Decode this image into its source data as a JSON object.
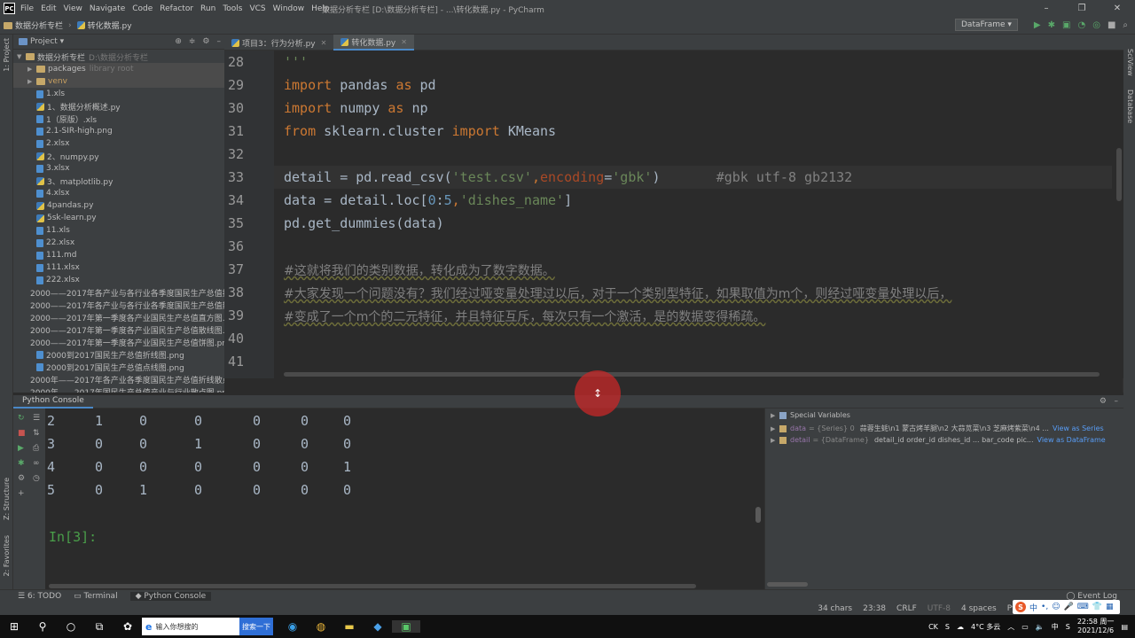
{
  "titlebar": {
    "logo": "PC",
    "menu": [
      "File",
      "Edit",
      "View",
      "Navigate",
      "Code",
      "Refactor",
      "Run",
      "Tools",
      "VCS",
      "Window",
      "Help"
    ],
    "window_title": "数据分析专栏 [D:\\数据分析专栏] - ...\\转化数据.py - PyCharm",
    "controls": [
      "–",
      "❐",
      "✕"
    ]
  },
  "navbar": {
    "crumbs": [
      "数据分析专栏",
      "转化数据.py"
    ],
    "run_config": "DataFrame ▾"
  },
  "project_panel": {
    "title": "Project ▾",
    "tree": [
      {
        "name": "数据分析专栏",
        "extra": "D:\\数据分析专栏",
        "type": "folder",
        "arrow": "▼"
      },
      {
        "name": "packages",
        "extra": "library root",
        "type": "folder",
        "arrow": "▶"
      },
      {
        "name": "venv",
        "extra": "",
        "type": "folder",
        "arrow": "▶"
      },
      {
        "name": "1.xls",
        "extra": "",
        "type": "file",
        "arrow": ""
      },
      {
        "name": "1、数据分析概述.py",
        "extra": "",
        "type": "py",
        "arrow": ""
      },
      {
        "name": "1（原版）.xls",
        "extra": "",
        "type": "file",
        "arrow": ""
      },
      {
        "name": "2.1-SIR-high.png",
        "extra": "",
        "type": "file",
        "arrow": ""
      },
      {
        "name": "2.xlsx",
        "extra": "",
        "type": "file",
        "arrow": ""
      },
      {
        "name": "2、numpy.py",
        "extra": "",
        "type": "py",
        "arrow": ""
      },
      {
        "name": "3.xlsx",
        "extra": "",
        "type": "file",
        "arrow": ""
      },
      {
        "name": "3、matplotlib.py",
        "extra": "",
        "type": "py",
        "arrow": ""
      },
      {
        "name": "4.xlsx",
        "extra": "",
        "type": "file",
        "arrow": ""
      },
      {
        "name": "4pandas.py",
        "extra": "",
        "type": "py",
        "arrow": ""
      },
      {
        "name": "5sk-learn.py",
        "extra": "",
        "type": "py",
        "arrow": ""
      },
      {
        "name": "11.xls",
        "extra": "",
        "type": "file",
        "arrow": ""
      },
      {
        "name": "22.xlsx",
        "extra": "",
        "type": "file",
        "arrow": ""
      },
      {
        "name": "111.md",
        "extra": "",
        "type": "file",
        "arrow": ""
      },
      {
        "name": "111.xlsx",
        "extra": "",
        "type": "file",
        "arrow": ""
      },
      {
        "name": "222.xlsx",
        "extra": "",
        "type": "file",
        "arrow": ""
      },
      {
        "name": "2000——2017年各产业与各行业各季度国民生产总值折",
        "extra": "",
        "type": "file",
        "arrow": ""
      },
      {
        "name": "2000——2017年各产业与各行业各季度国民生产总值散",
        "extra": "",
        "type": "file",
        "arrow": ""
      },
      {
        "name": "2000——2017年第一季度各产业国民生产总值直方图.png",
        "extra": "",
        "type": "file",
        "arrow": ""
      },
      {
        "name": "2000——2017年第一季度各产业国民生产总值散线图.pn",
        "extra": "",
        "type": "file",
        "arrow": ""
      },
      {
        "name": "2000——2017年第一季度各产业国民生产总值饼图.png",
        "extra": "",
        "type": "file",
        "arrow": ""
      },
      {
        "name": "2000到2017国民生产总值折线图.png",
        "extra": "",
        "type": "file",
        "arrow": ""
      },
      {
        "name": "2000到2017国民生产总值点线图.png",
        "extra": "",
        "type": "file",
        "arrow": ""
      },
      {
        "name": "2000年——2017年各产业各季度国民生产总值折线散点",
        "extra": "",
        "type": "file",
        "arrow": ""
      },
      {
        "name": "2000年——2017年国民生产总值产业与行业散点图.png",
        "extra": "",
        "type": "file",
        "arrow": ""
      }
    ]
  },
  "tabs": [
    {
      "label": "项目3：行为分析.py",
      "active": false
    },
    {
      "label": "转化数据.py",
      "active": true
    }
  ],
  "editor": {
    "lines": [
      {
        "n": "28",
        "html": "<span class='st'>'''</span>"
      },
      {
        "n": "29",
        "html": "<span class='kw'>import</span> pandas <span class='kw'>as</span> pd"
      },
      {
        "n": "30",
        "html": "<span class='kw'>import</span> numpy <span class='kw'>as</span> np"
      },
      {
        "n": "31",
        "html": "<span class='kw'>from</span> sklearn.cluster <span class='kw'>import</span> KMeans"
      },
      {
        "n": "32",
        "html": ""
      },
      {
        "n": "33",
        "html": "detail = pd.read_csv(<span class='st'>'test.csv'</span><span class='kw'>,</span><span class='pa'>encoding</span>=<span class='st'>'gbk'</span>)       <span class='cm'>#gbk utf-8 gb2132</span>"
      },
      {
        "n": "34",
        "html": "data = detail.loc[<span class='nu'>0</span>:<span class='nu'>5</span><span class='kw'>,</span><span class='st'>'dishes_name'</span>]"
      },
      {
        "n": "35",
        "html": "pd.get_dummies(data)"
      },
      {
        "n": "36",
        "html": ""
      },
      {
        "n": "37",
        "html": "<span class='cmz'>#这就将我们的类别数据，转化成为了数字数据。</span>"
      },
      {
        "n": "38",
        "html": "<span class='cmz'>#大家发现一个问题没有？我们经过哑变量处理过以后，对于一个类别型特征，如果取值为m个，则经过哑变量处理以后，</span>"
      },
      {
        "n": "39",
        "html": "<span class='cmz'>#变成了一个m个的二元特征，并且特征互斥，每次只有一个激活，是的数据变得稀疏。</span>"
      },
      {
        "n": "40",
        "html": ""
      },
      {
        "n": "41",
        "html": ""
      }
    ]
  },
  "console": {
    "title": "Python Console",
    "rows": [
      [
        "2",
        "1",
        "0",
        "0",
        "0",
        "0",
        "0"
      ],
      [
        "3",
        "0",
        "0",
        "1",
        "0",
        "0",
        "0"
      ],
      [
        "4",
        "0",
        "0",
        "0",
        "0",
        "0",
        "1"
      ],
      [
        "5",
        "0",
        "1",
        "0",
        "0",
        "0",
        "0"
      ]
    ],
    "prompt": "In[3]:"
  },
  "variables": {
    "header": "Special Variables",
    "items": [
      {
        "name": "data",
        "type": "= {Series} 0",
        "value": "蒜蓉生蚝\\n1    蒙古烤羊腿\\n2    大蒜苋菜\\n3    芝麻烤紫菜\\n4 ...",
        "link": "View as Series"
      },
      {
        "name": "detail",
        "type": "= {DataFrame}",
        "value": "detail_id  order_id  dishes_id  ...  bar_code    pic...",
        "link": "View as DataFrame"
      }
    ]
  },
  "toolwindows": {
    "todo": "6: TODO",
    "terminal": "Terminal",
    "console": "Python Console",
    "event_log": "Event Log"
  },
  "status": {
    "chars": "34 chars",
    "pos": "23:38",
    "crlf": "CRLF",
    "enc": "UTF-8",
    "indent": "4 spaces",
    "interp": "Pyt"
  },
  "ime": [
    "S",
    "中",
    "•,",
    "☺",
    "🎤",
    "⌨",
    "👕",
    "▦"
  ],
  "taskbar": {
    "search_placeholder": "输入你想搜的",
    "search_button": "搜索一下",
    "weather": "4°C 多云",
    "lang": "中",
    "time": "22:58 周一",
    "date": "2021/12/6"
  },
  "strips": {
    "left_top": "1: Project",
    "left_mid": "Z: Structure",
    "left_bot": "2: Favorites",
    "right_top": "SciView",
    "right_mid": "Database"
  }
}
